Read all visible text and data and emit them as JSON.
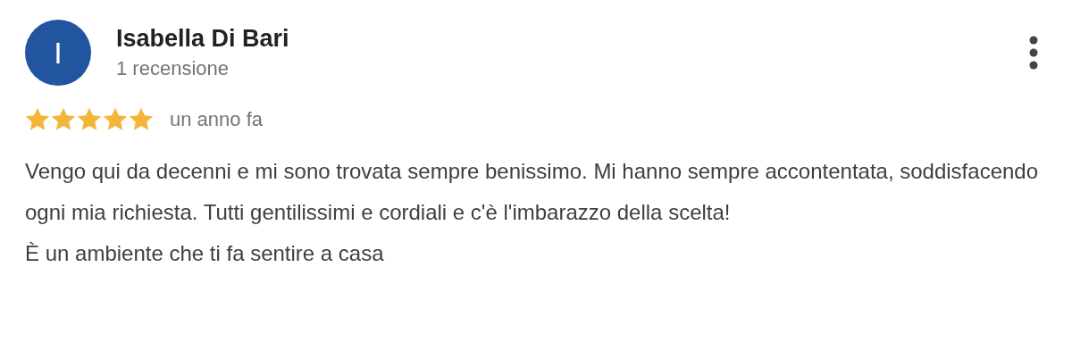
{
  "review": {
    "avatar_letter": "I",
    "author": "Isabella Di Bari",
    "review_count": "1 recensione",
    "stars": 5,
    "time": "un anno fa",
    "paragraphs": [
      "Vengo qui da decenni e mi sono trovata sempre benissimo. Mi hanno sempre accontentata, soddisfacendo ogni mia richiesta. Tutti gentilissimi e cordiali e c'è l'imbarazzo della scelta!",
      "È un ambiente che ti fa sentire a casa"
    ]
  }
}
